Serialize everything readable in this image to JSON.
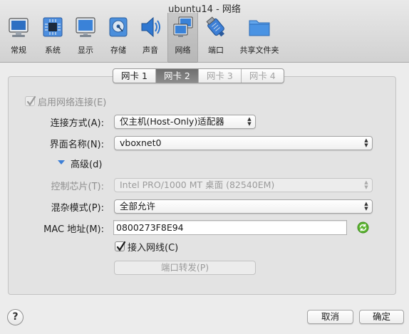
{
  "window": {
    "title": "ubuntu14 - 网络"
  },
  "toolbar": {
    "items": [
      {
        "label": "常规",
        "icon": "general-icon"
      },
      {
        "label": "系统",
        "icon": "system-icon"
      },
      {
        "label": "显示",
        "icon": "display-icon"
      },
      {
        "label": "存储",
        "icon": "storage-icon"
      },
      {
        "label": "声音",
        "icon": "audio-icon"
      },
      {
        "label": "网络",
        "icon": "network-icon",
        "selected": true
      },
      {
        "label": "端口",
        "icon": "ports-icon"
      },
      {
        "label": "共享文件夹",
        "icon": "shared-folder-icon"
      }
    ]
  },
  "tabs": [
    {
      "label": "网卡 1",
      "state": "normal"
    },
    {
      "label": "网卡 2",
      "state": "active"
    },
    {
      "label": "网卡 3",
      "state": "disabled"
    },
    {
      "label": "网卡 4",
      "state": "disabled"
    }
  ],
  "form": {
    "enable_label": "启用网络连接(E)",
    "enable_checked": true,
    "attached_label": "连接方式(A):",
    "attached_value": "仅主机(Host-Only)适配器",
    "name_label": "界面名称(N):",
    "name_value": "vboxnet0",
    "advanced_label": "高级(d)",
    "adapter_label": "控制芯片(T):",
    "adapter_value": "Intel PRO/1000 MT 桌面 (82540EM)",
    "promisc_label": "混杂模式(P):",
    "promisc_value": "全部允许",
    "mac_label": "MAC 地址(M):",
    "mac_value": "0800273F8E94",
    "cable_label": "接入网线(C)",
    "cable_checked": true,
    "port_forward_label": "端口转发(P)"
  },
  "footer": {
    "help_label": "?",
    "cancel_label": "取消",
    "ok_label": "确定"
  },
  "colors": {
    "accent_blue": "#3d7fd6",
    "refresh_green": "#5cb531"
  }
}
